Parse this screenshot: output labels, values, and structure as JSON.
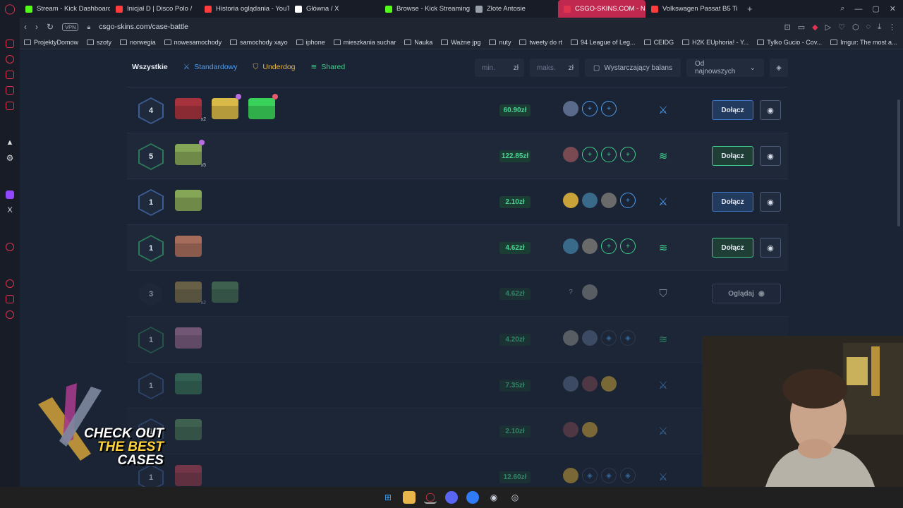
{
  "browser": {
    "tabs": [
      {
        "title": "Stream - Kick Dashboard",
        "color": "#53fc18"
      },
      {
        "title": "Inicjał D | Disco Polo /",
        "color": "#ff3b3b"
      },
      {
        "title": "Historia oglądania - YouT",
        "color": "#ff3b3b"
      },
      {
        "title": "Główna / X",
        "color": "#ffffff"
      },
      {
        "title": "Browse - Kick Streaming",
        "color": "#53fc18"
      },
      {
        "title": "Złote Antosie",
        "color": "#9aa0aa"
      },
      {
        "title": "CSGO-SKINS.COM - Naj",
        "color": "#e0334f",
        "active": true
      },
      {
        "title": "Volkswagen Passat B5 Ti",
        "color": "#ff3b3b"
      }
    ],
    "vpn_label": "VPN",
    "url": "csgo-skins.com/case-battle",
    "bookmarks": [
      "ProjektyDomow",
      "szoty",
      "norwegia",
      "nowesamochody",
      "samochody xayo",
      "iphone",
      "mieszkania suchar",
      "Nauka",
      "Ważne jpg",
      "nuty",
      "tweety do rt",
      "94 League of Leg...",
      "CEIDG",
      "H2K EUphoria! - Y...",
      "Tylko Gucio - Cov...",
      "Imgur: The most a..."
    ]
  },
  "filters": {
    "all": "Wszystkie",
    "standard": "Standardowy",
    "underdog": "Underdog",
    "shared": "Shared",
    "min_placeholder": "min.",
    "max_placeholder": "maks.",
    "currency": "zł",
    "balance_label": "Wystarczający balans",
    "sort_label": "Od najnowszych"
  },
  "colors": {
    "standard": "#4d9ef0",
    "shared": "#3fd08c",
    "underdog": "#e8b84a",
    "active_tab": "#c0284f"
  },
  "battles": [
    {
      "rounds": "4",
      "mode": "standard",
      "cases": [
        {
          "color": "#8a2a33",
          "mult": "x2"
        },
        {
          "color": "#b59a3c",
          "badge": "purple"
        },
        {
          "color": "#2fae4a",
          "badge": "red"
        }
      ],
      "price": "60.90zł",
      "players": [
        "avatar",
        "slot",
        "slot"
      ],
      "action": "Dołącz"
    },
    {
      "rounds": "5",
      "mode": "shared",
      "cases": [
        {
          "color": "#6f8a48",
          "mult": "x5",
          "badge": "purple"
        }
      ],
      "price": "122.85zł",
      "players": [
        "avatar",
        "slot",
        "slot",
        "slot"
      ],
      "action": "Dołącz"
    },
    {
      "rounds": "1",
      "mode": "standard",
      "cases": [
        {
          "color": "#6f8a48"
        }
      ],
      "price": "2.10zł",
      "players": [
        "avatar",
        "avatar",
        "avatar",
        "slot"
      ],
      "action": "Dołącz"
    },
    {
      "rounds": "1",
      "mode": "shared",
      "cases": [
        {
          "color": "#8a5a4c"
        }
      ],
      "price": "4.62zł",
      "players": [
        "avatar",
        "avatar",
        "slot",
        "slot"
      ],
      "action": "Dołącz"
    },
    {
      "rounds": "3",
      "mode": "underdog",
      "dim": true,
      "cases": [
        {
          "color": "#8a7a48",
          "mult": "x2"
        },
        {
          "color": "#4a7a55"
        }
      ],
      "price": "4.62zł",
      "players": [
        "q",
        "avatar"
      ],
      "action": "Oglądaj"
    },
    {
      "rounds": "1",
      "mode": "shared",
      "dim": true,
      "cases": [
        {
          "color": "#9a6a90"
        }
      ],
      "price": "4.20zł",
      "players": [
        "avatar",
        "avatar",
        "wait",
        "wait"
      ],
      "action": ""
    },
    {
      "rounds": "1",
      "mode": "standard",
      "dim": true,
      "cases": [
        {
          "color": "#3a7a5a"
        }
      ],
      "price": "7.35zł",
      "players": [
        "avatar",
        "avatar",
        "avatar"
      ],
      "action": ""
    },
    {
      "rounds": "1",
      "mode": "standard",
      "dim": true,
      "cases": [
        {
          "color": "#4a7a55"
        }
      ],
      "price": "2.10zł",
      "players": [
        "avatar",
        "avatar"
      ],
      "action": ""
    },
    {
      "rounds": "1",
      "mode": "standard",
      "dim": true,
      "cases": [
        {
          "color": "#9a3a4a"
        }
      ],
      "price": "12.60zł",
      "players": [
        "avatar",
        "wait",
        "wait",
        "wait"
      ],
      "action": ""
    }
  ],
  "promo": {
    "line1": "CHECK OUT",
    "line2": "THE BEST",
    "line3": "CASES"
  }
}
